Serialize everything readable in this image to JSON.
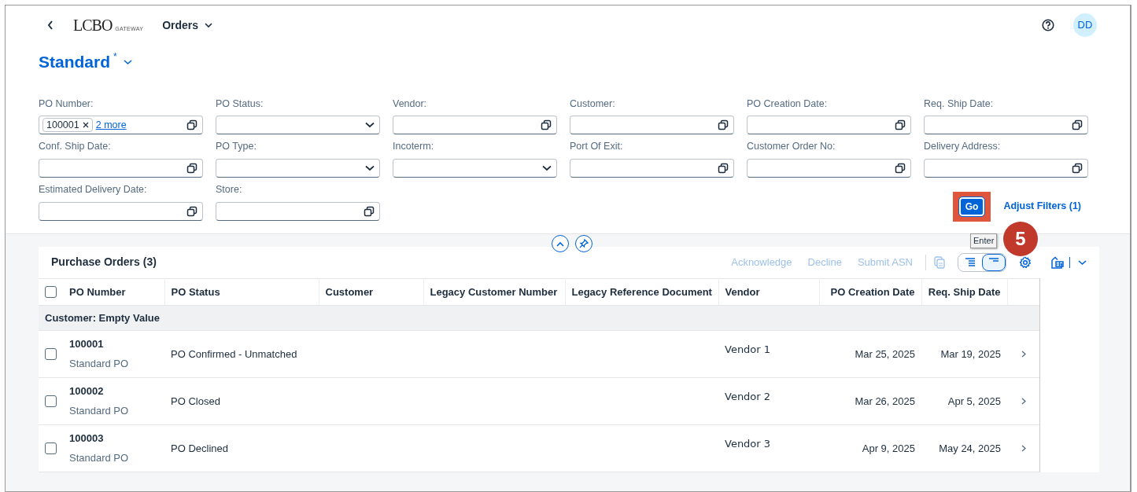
{
  "shell": {
    "logo": "LCBO",
    "logo_sub": "GATEWAY",
    "app": "Orders",
    "avatar": "DD"
  },
  "variant": {
    "title": "Standard",
    "modified_mark": "*"
  },
  "filters": [
    {
      "label": "PO Number:",
      "kind": "help",
      "token": "100001",
      "more": "2 more"
    },
    {
      "label": "PO Status:",
      "kind": "select"
    },
    {
      "label": "Vendor:",
      "kind": "help"
    },
    {
      "label": "Customer:",
      "kind": "help"
    },
    {
      "label": "PO Creation Date:",
      "kind": "help"
    },
    {
      "label": "Req. Ship Date:",
      "kind": "help"
    },
    {
      "label": "Conf. Ship Date:",
      "kind": "help"
    },
    {
      "label": "PO Type:",
      "kind": "select"
    },
    {
      "label": "Incoterm:",
      "kind": "select"
    },
    {
      "label": "Port Of Exit:",
      "kind": "help"
    },
    {
      "label": "Customer Order No:",
      "kind": "help"
    },
    {
      "label": "Delivery Address:",
      "kind": "help"
    },
    {
      "label": "Estimated Delivery Date:",
      "kind": "help"
    },
    {
      "label": "Store:",
      "kind": "help"
    }
  ],
  "filter_bar": {
    "go": "Go",
    "tooltip": "Enter",
    "adjust": "Adjust Filters (1)"
  },
  "step_marker": "5",
  "table": {
    "title": "Purchase Orders (3)",
    "actions": [
      {
        "label": "Acknowledge",
        "disabled": true
      },
      {
        "label": "Decline",
        "disabled": true
      },
      {
        "label": "Submit ASN",
        "disabled": true
      }
    ],
    "view_toggle": [
      {
        "selected": false
      },
      {
        "selected": true
      }
    ],
    "select_all": {
      "checked": false
    },
    "columns": [
      {
        "label": "PO Number"
      },
      {
        "label": "PO Status"
      },
      {
        "label": "Customer"
      },
      {
        "label": "Legacy Customer Number"
      },
      {
        "label": "Legacy Reference Document"
      },
      {
        "label": "Vendor"
      },
      {
        "label": "PO Creation Date"
      },
      {
        "label": "Req. Ship Date"
      }
    ],
    "group": "Customer: Empty Value",
    "rows": [
      {
        "checked": false,
        "po_number": "100001",
        "po_type": "Standard PO",
        "status": "PO Confirmed - Unmatched",
        "vendor": "Vendor 1",
        "created": "Mar 25, 2025",
        "ship": "Mar 19, 2025"
      },
      {
        "checked": false,
        "po_number": "100002",
        "po_type": "Standard PO",
        "status": "PO Closed",
        "vendor": "Vendor 2",
        "created": "Mar 26, 2025",
        "ship": "Apr 5, 2025"
      },
      {
        "checked": false,
        "po_number": "100003",
        "po_type": "Standard PO",
        "status": "PO Declined",
        "vendor": "Vendor 3",
        "created": "Apr 9, 2025",
        "ship": "May 24, 2025"
      }
    ]
  }
}
